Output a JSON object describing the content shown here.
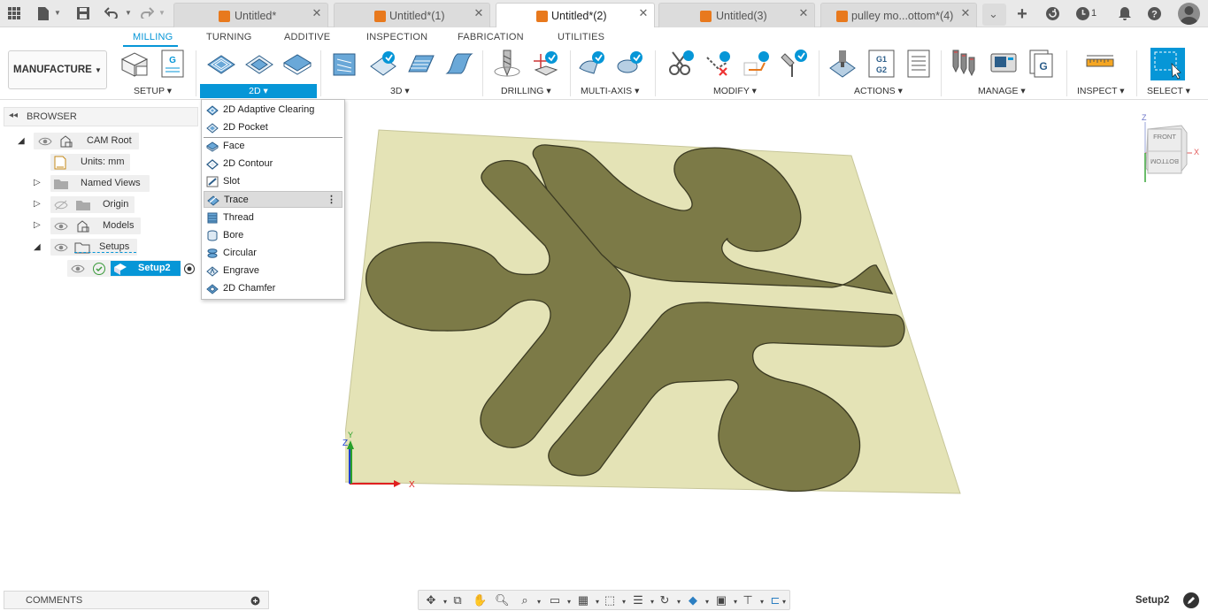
{
  "titlebar": {
    "tabs": [
      {
        "label": "Untitled*",
        "active": false
      },
      {
        "label": "Untitled*(1)",
        "active": false
      },
      {
        "label": "Untitled*(2)",
        "active": true
      },
      {
        "label": "Untitled(3)",
        "active": false
      },
      {
        "label": "pulley mo...ottom*(4)",
        "active": false
      }
    ],
    "job_count": "1",
    "icons": [
      "grid-icon",
      "file-icon",
      "save-icon",
      "undo-icon",
      "redo-icon",
      "plus-icon",
      "refresh-icon",
      "clock-icon",
      "bell-icon",
      "help-icon",
      "user-avatar"
    ]
  },
  "ribbon": {
    "workspace": "MANUFACTURE",
    "tabs": [
      "MILLING",
      "TURNING",
      "ADDITIVE",
      "INSPECTION",
      "FABRICATION",
      "UTILITIES"
    ],
    "active_tab": "MILLING",
    "groups": [
      "SETUP",
      "2D",
      "3D",
      "DRILLING",
      "MULTI-AXIS",
      "MODIFY",
      "ACTIONS",
      "MANAGE",
      "INSPECT",
      "SELECT"
    ],
    "active_group": "2D"
  },
  "browser": {
    "title": "BROWSER",
    "items": [
      {
        "label": "CAM Root"
      },
      {
        "label": "Units: mm"
      },
      {
        "label": "Named Views"
      },
      {
        "label": "Origin"
      },
      {
        "label": "Models"
      },
      {
        "label": "Setups"
      },
      {
        "label": "Setup2",
        "selected": true
      }
    ]
  },
  "dropdown_2d": {
    "items": [
      {
        "label": "2D Adaptive Clearing",
        "icon": "adaptive-clearing-icon"
      },
      {
        "label": "2D Pocket",
        "icon": "pocket-icon"
      },
      {
        "label": "Face",
        "icon": "face-icon"
      },
      {
        "label": "2D Contour",
        "icon": "contour-icon"
      },
      {
        "label": "Slot",
        "icon": "slot-icon"
      },
      {
        "label": "Trace",
        "icon": "trace-icon",
        "highlighted": true
      },
      {
        "label": "Thread",
        "icon": "thread-icon"
      },
      {
        "label": "Bore",
        "icon": "bore-icon"
      },
      {
        "label": "Circular",
        "icon": "circular-icon"
      },
      {
        "label": "Engrave",
        "icon": "engrave-icon"
      },
      {
        "label": "2D Chamfer",
        "icon": "chamfer-icon"
      }
    ]
  },
  "viewcube": {
    "top": "Z",
    "right": "X",
    "front": "FRONT",
    "bottom": "BOTTOM"
  },
  "triad": {
    "x": "X",
    "y": "Y",
    "z": "Z"
  },
  "comments": {
    "label": "COMMENTS"
  },
  "status": {
    "text": "Setup2"
  },
  "colors": {
    "accent": "#0696d7",
    "tab_cube": "#e8791d",
    "stock": "#e4e3b6",
    "part": "#7c7a47"
  }
}
